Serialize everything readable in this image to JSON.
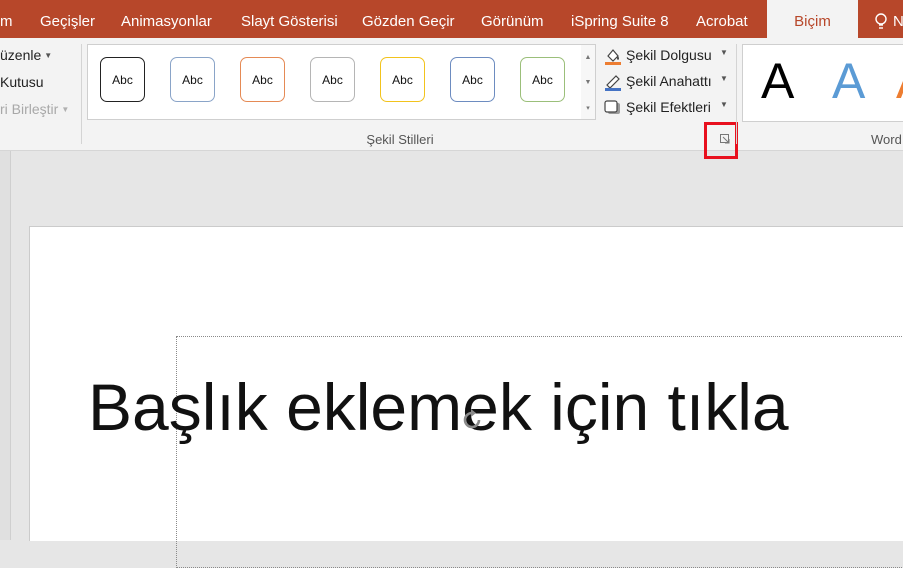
{
  "tabs": [
    {
      "label": "m"
    },
    {
      "label": "Geçişler"
    },
    {
      "label": "Animasyonlar"
    },
    {
      "label": "Slayt Gösterisi"
    },
    {
      "label": "Gözden Geçir"
    },
    {
      "label": "Görünüm"
    },
    {
      "label": "iSpring Suite 8"
    },
    {
      "label": "Acrobat"
    },
    {
      "label": "Biçim",
      "active": true
    },
    {
      "label": "N"
    }
  ],
  "ribbon": {
    "left_group": {
      "arrange_label": "üzenle",
      "textbox_label": "Kutusu",
      "merge_label": "ri Birleştir"
    },
    "shape_styles": {
      "group_label": "Şekil Stilleri",
      "swatches": [
        {
          "text": "Abc",
          "border": "#222222"
        },
        {
          "text": "Abc",
          "border": "#8aa4c8"
        },
        {
          "text": "Abc",
          "border": "#e58a55"
        },
        {
          "text": "Abc",
          "border": "#b5b5b5"
        },
        {
          "text": "Abc",
          "border": "#f2c31d"
        },
        {
          "text": "Abc",
          "border": "#6d8cc0"
        },
        {
          "text": "Abc",
          "border": "#9bbf7a"
        }
      ],
      "fill_label": "Şekil Dolgusu",
      "outline_label": "Şekil Anahattı",
      "effects_label": "Şekil Efektleri"
    },
    "wordart": {
      "group_label": "Word",
      "letters": [
        {
          "text": "A",
          "color": "#000000"
        },
        {
          "text": "A",
          "color": "#5b9bd5"
        },
        {
          "text": "A",
          "color": "#ed7d31"
        }
      ]
    }
  },
  "slide": {
    "title_placeholder": "Başlık eklemek için tıkla"
  },
  "colors": {
    "accent": "#b7472a",
    "highlight": "#e8101e"
  }
}
